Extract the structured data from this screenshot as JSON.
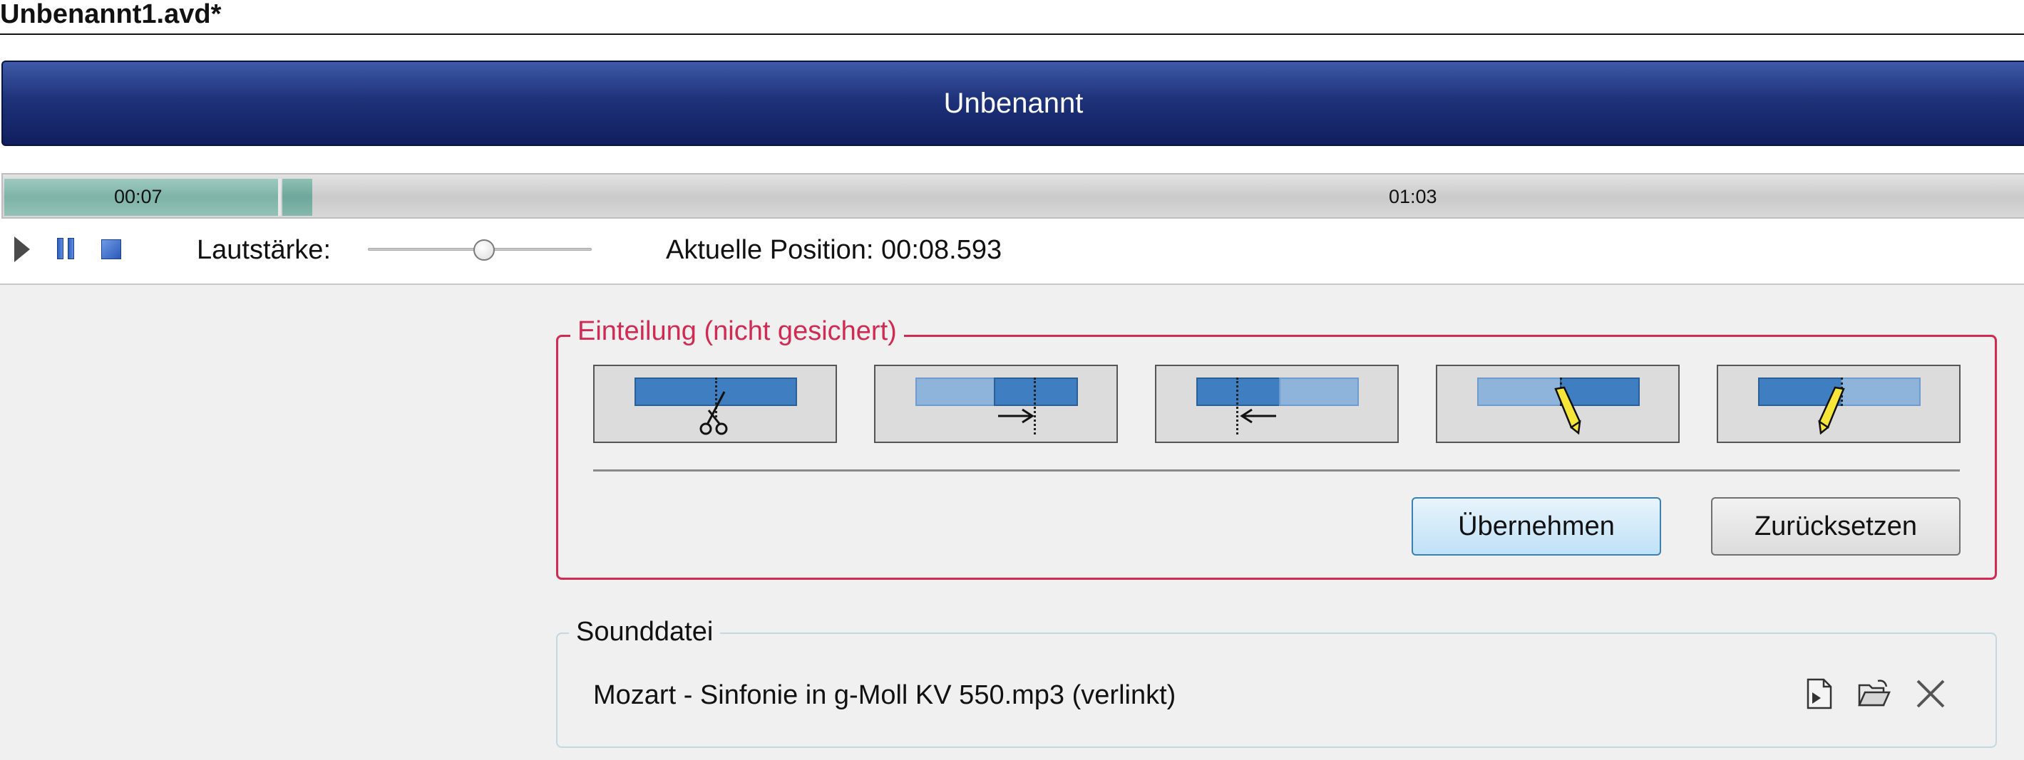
{
  "window": {
    "title": "Unbenannt1.avd*"
  },
  "header": {
    "title": "Unbenannt"
  },
  "timeline": {
    "segment_start_label": "00:07",
    "segment_end_label": "01:03"
  },
  "transport": {
    "volume_label": "Lautstärke:",
    "volume_level": 0.52,
    "position_label": "Aktuelle Position: 00:08.593"
  },
  "einteilung": {
    "legend": "Einteilung (nicht gesichert)",
    "tools": [
      {
        "name": "split",
        "icon": "scissors-icon"
      },
      {
        "name": "move-boundary-right",
        "icon": "arrow-right-icon"
      },
      {
        "name": "move-boundary-left",
        "icon": "arrow-left-icon"
      },
      {
        "name": "edit-right",
        "icon": "pencil-icon"
      },
      {
        "name": "edit-left",
        "icon": "pencil-icon"
      }
    ],
    "apply_label": "Übernehmen",
    "reset_label": "Zurücksetzen"
  },
  "sound": {
    "legend": "Sounddatei",
    "file": "Mozart - Sinfonie in g-Moll KV 550.mp3 (verlinkt)",
    "icons": [
      "new-file-icon",
      "open-folder-icon",
      "close-icon"
    ]
  },
  "colors": {
    "banner": "#1e327a",
    "accent_red": "#d22a52",
    "segment": "#7fb3a8"
  }
}
